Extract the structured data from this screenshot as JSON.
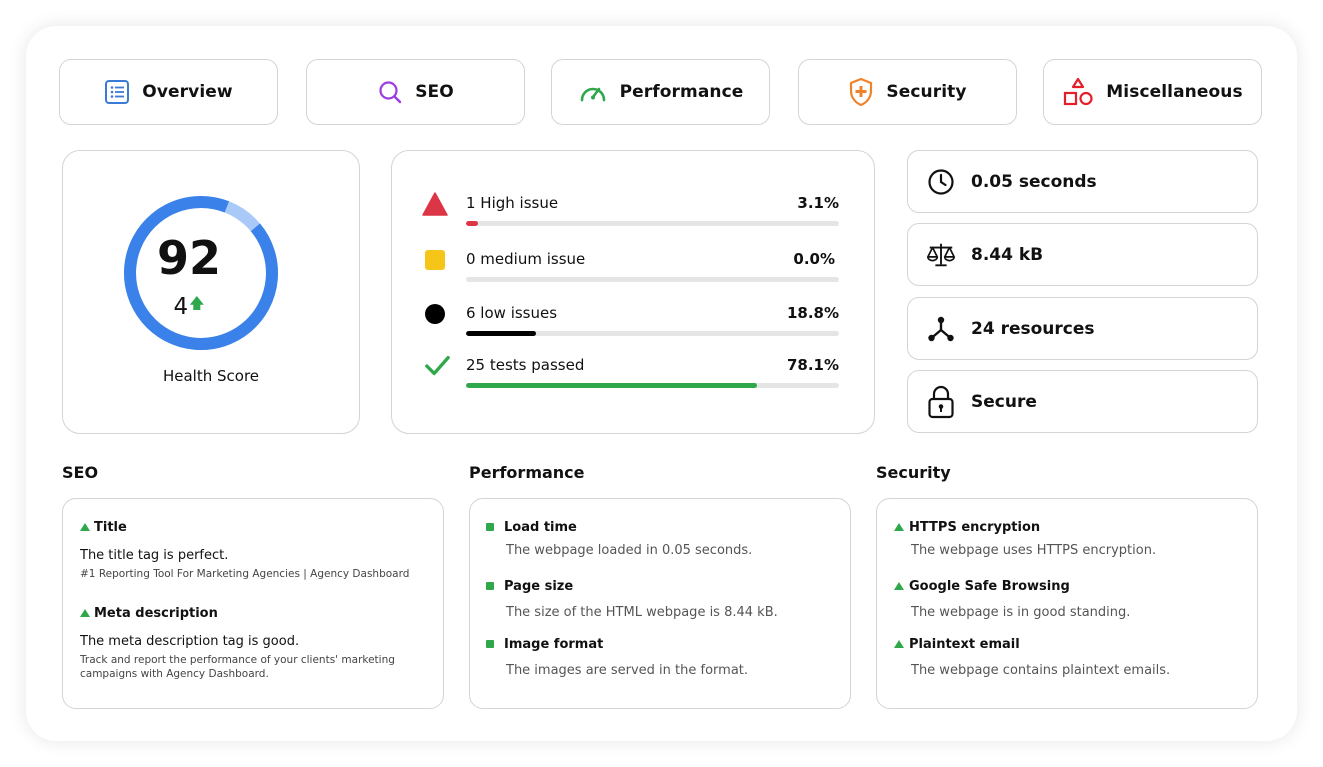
{
  "tabs": [
    {
      "label": "Overview",
      "icon": "list-icon",
      "color": "#3a7bd5"
    },
    {
      "label": "SEO",
      "icon": "search-icon",
      "color": "#9b3de0"
    },
    {
      "label": "Performance",
      "icon": "speedometer-icon",
      "color": "#2ea84a"
    },
    {
      "label": "Security",
      "icon": "shield-icon",
      "color": "#f0822a"
    },
    {
      "label": "Miscellaneous",
      "icon": "shapes-icon",
      "color": "#e3202a"
    }
  ],
  "health": {
    "score": "92",
    "delta": "4",
    "label": "Health Score",
    "ring_color": "#3a82ea",
    "ring_light_color": "#a9c9f8",
    "fraction": 0.92
  },
  "issues": [
    {
      "label": "1 High issue",
      "pct": "3.1%",
      "fill": 0.031,
      "color": "#dc3545",
      "icon": "warning-triangle-icon"
    },
    {
      "label": "0 medium issue",
      "pct": "0.0%",
      "fill": 0.0,
      "color": "#f5c518",
      "icon": "square-icon"
    },
    {
      "label": "6 low issues",
      "pct": "18.8%",
      "fill": 0.188,
      "color": "#000000",
      "icon": "circle-icon"
    },
    {
      "label": "25 tests passed",
      "pct": "78.1%",
      "fill": 0.781,
      "color": "#2ea84a",
      "icon": "checkmark-icon"
    }
  ],
  "stats": [
    {
      "text": "0.05 seconds",
      "icon": "clock-icon"
    },
    {
      "text": "8.44 kB",
      "icon": "scale-icon"
    },
    {
      "text": "24 resources",
      "icon": "branch-icon"
    },
    {
      "text": "Secure",
      "icon": "lock-icon"
    }
  ],
  "seo": {
    "title": "SEO",
    "items": [
      {
        "heading": "Title",
        "status": "The title tag is perfect.",
        "detail": "#1 Reporting Tool For Marketing Agencies | Agency Dashboard"
      },
      {
        "heading": "Meta description",
        "status": "The meta description tag is good.",
        "detail": "Track and report the performance of your clients' marketing campaigns with Agency Dashboard."
      }
    ]
  },
  "performance": {
    "title": "Performance",
    "items": [
      {
        "heading": "Load time",
        "desc": "The webpage loaded in 0.05 seconds."
      },
      {
        "heading": "Page size",
        "desc": "The size of the HTML webpage is 8.44 kB."
      },
      {
        "heading": "Image format",
        "desc": "The images are served in the format."
      }
    ]
  },
  "security": {
    "title": "Security",
    "items": [
      {
        "heading": "HTTPS encryption",
        "desc": "The webpage uses HTTPS encryption."
      },
      {
        "heading": "Google Safe Browsing",
        "desc": "The webpage is in good standing."
      },
      {
        "heading": "Plaintext email",
        "desc": "The webpage contains plaintext emails."
      }
    ]
  }
}
